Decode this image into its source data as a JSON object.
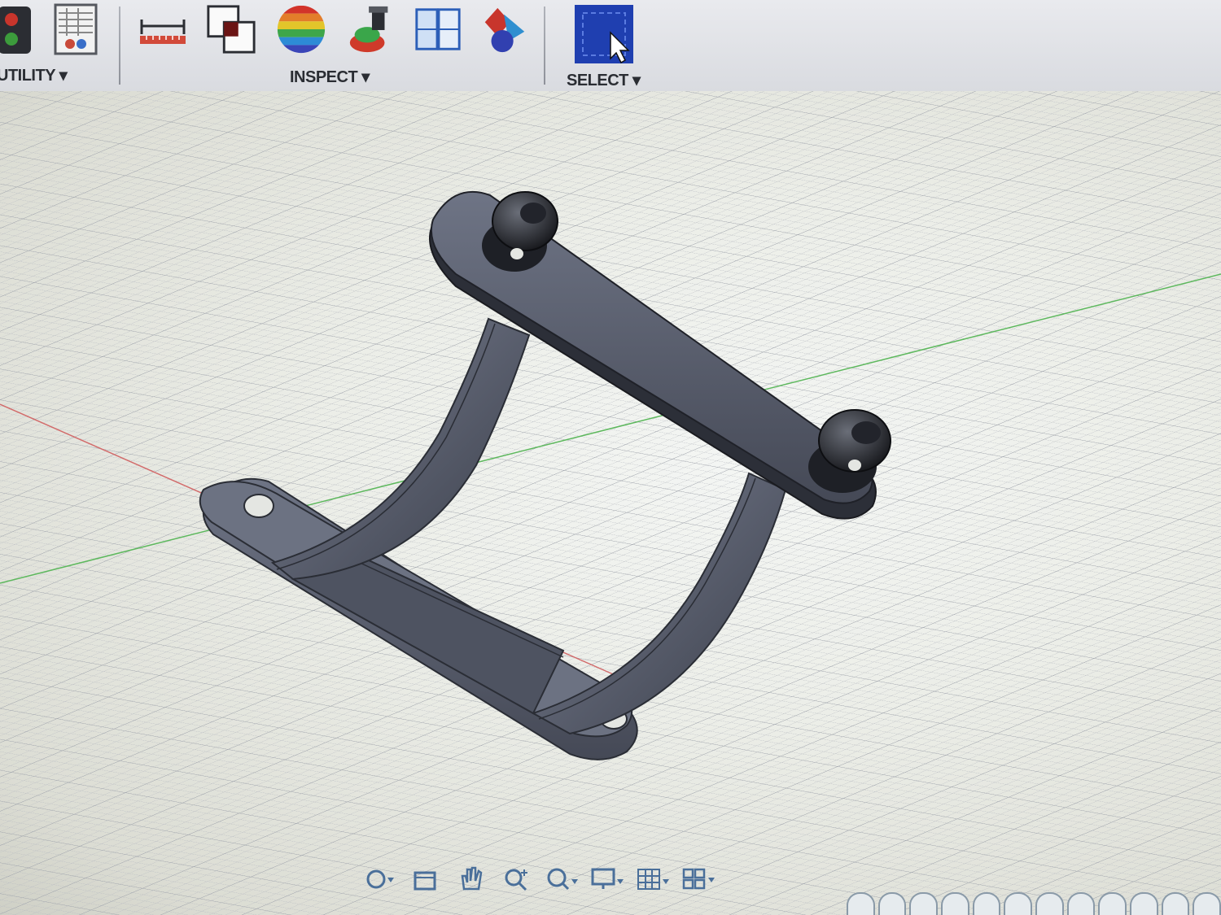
{
  "toolbar": {
    "groups": [
      {
        "label": "UTILITY ▾"
      },
      {
        "label": "INSPECT ▾"
      },
      {
        "label": "SELECT ▾"
      }
    ],
    "icons": [
      "utility-red-icon",
      "settings-table-icon",
      "measure-icon",
      "interference-icon",
      "zebra-analysis-icon",
      "center-of-mass-icon",
      "section-analysis-icon",
      "component-color-icon",
      "window-select-icon"
    ]
  },
  "viewport": {
    "model": "bracket-part",
    "grid": true
  },
  "navbar": {
    "buttons": [
      "orbit-icon",
      "look-at-icon",
      "pan-icon",
      "zoom-icon",
      "fit-icon",
      "display-settings-icon",
      "grid-settings-icon",
      "viewports-icon"
    ]
  },
  "colors": {
    "accent": "#1f3fb0",
    "model": "#5a5f6e",
    "grid": "#b9bcc2"
  }
}
